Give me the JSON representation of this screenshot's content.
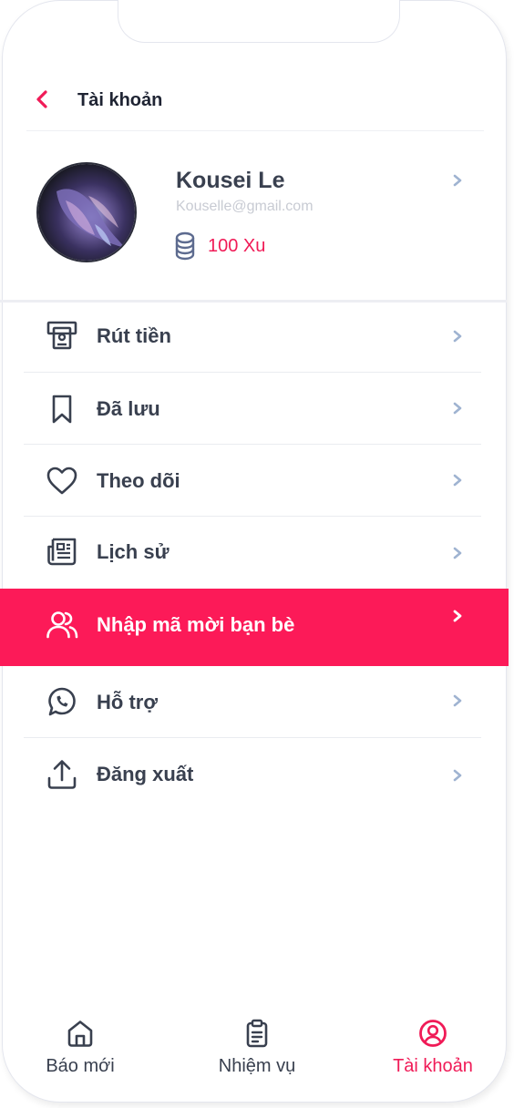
{
  "header": {
    "title": "Tài khoản",
    "back_icon": "chevron-left-icon"
  },
  "profile": {
    "name": "Kousei Le",
    "email": "Kouselle@gmail.com",
    "coins": "100 Xu",
    "avatar": "betta-fish-avatar",
    "coin_icon": "coin-stack-icon"
  },
  "menu": {
    "items": [
      {
        "label": "Rút tiền",
        "icon": "atm-withdraw-icon"
      },
      {
        "label": "Đã lưu",
        "icon": "bookmark-icon"
      },
      {
        "label": "Theo dõi",
        "icon": "heart-icon"
      },
      {
        "label": "Lịch sử",
        "icon": "newspaper-icon"
      },
      {
        "label": "Nhập mã mời bạn bè",
        "icon": "users-icon",
        "active": true
      },
      {
        "label": "Hỗ trợ",
        "icon": "whatsapp-icon"
      },
      {
        "label": "Đăng xuất",
        "icon": "upload-icon"
      }
    ]
  },
  "tabbar": {
    "tabs": [
      {
        "label": "Báo mới",
        "icon": "home-icon"
      },
      {
        "label": "Nhiệm vụ",
        "icon": "clipboard-icon"
      },
      {
        "label": "Tài khoản",
        "icon": "user-circle-icon",
        "active": true
      }
    ]
  },
  "colors": {
    "accent": "#fc1a58",
    "text": "#39404f",
    "chevron": "#9fb3d1",
    "muted": "#c8cbd3"
  }
}
